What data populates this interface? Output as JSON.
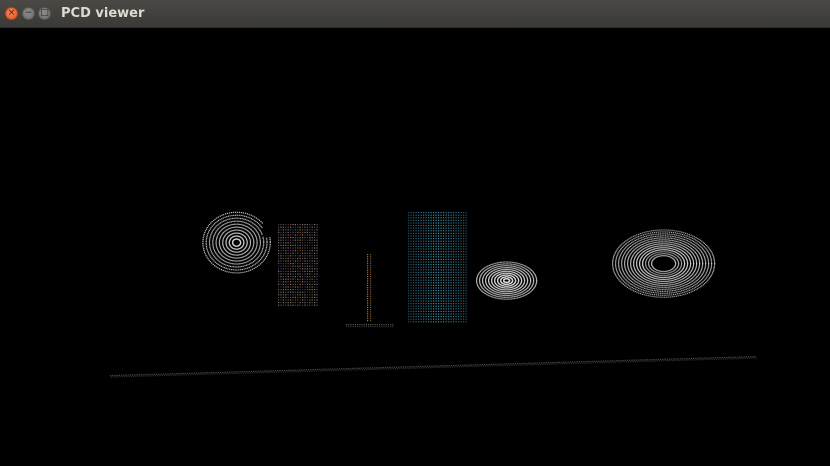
{
  "window": {
    "title": "PCD viewer",
    "close_glyph": "×",
    "minimize_glyph": "−",
    "maximize_glyph": "□"
  },
  "colors": {
    "background": "#000000",
    "titlebar": "#3c3b37",
    "close_button": "#e95420",
    "point_white": "#d8d8d8",
    "point_cyan": "#4fb6d6",
    "point_orange": "#d08a45",
    "point_gray": "#8a8a8a"
  }
}
